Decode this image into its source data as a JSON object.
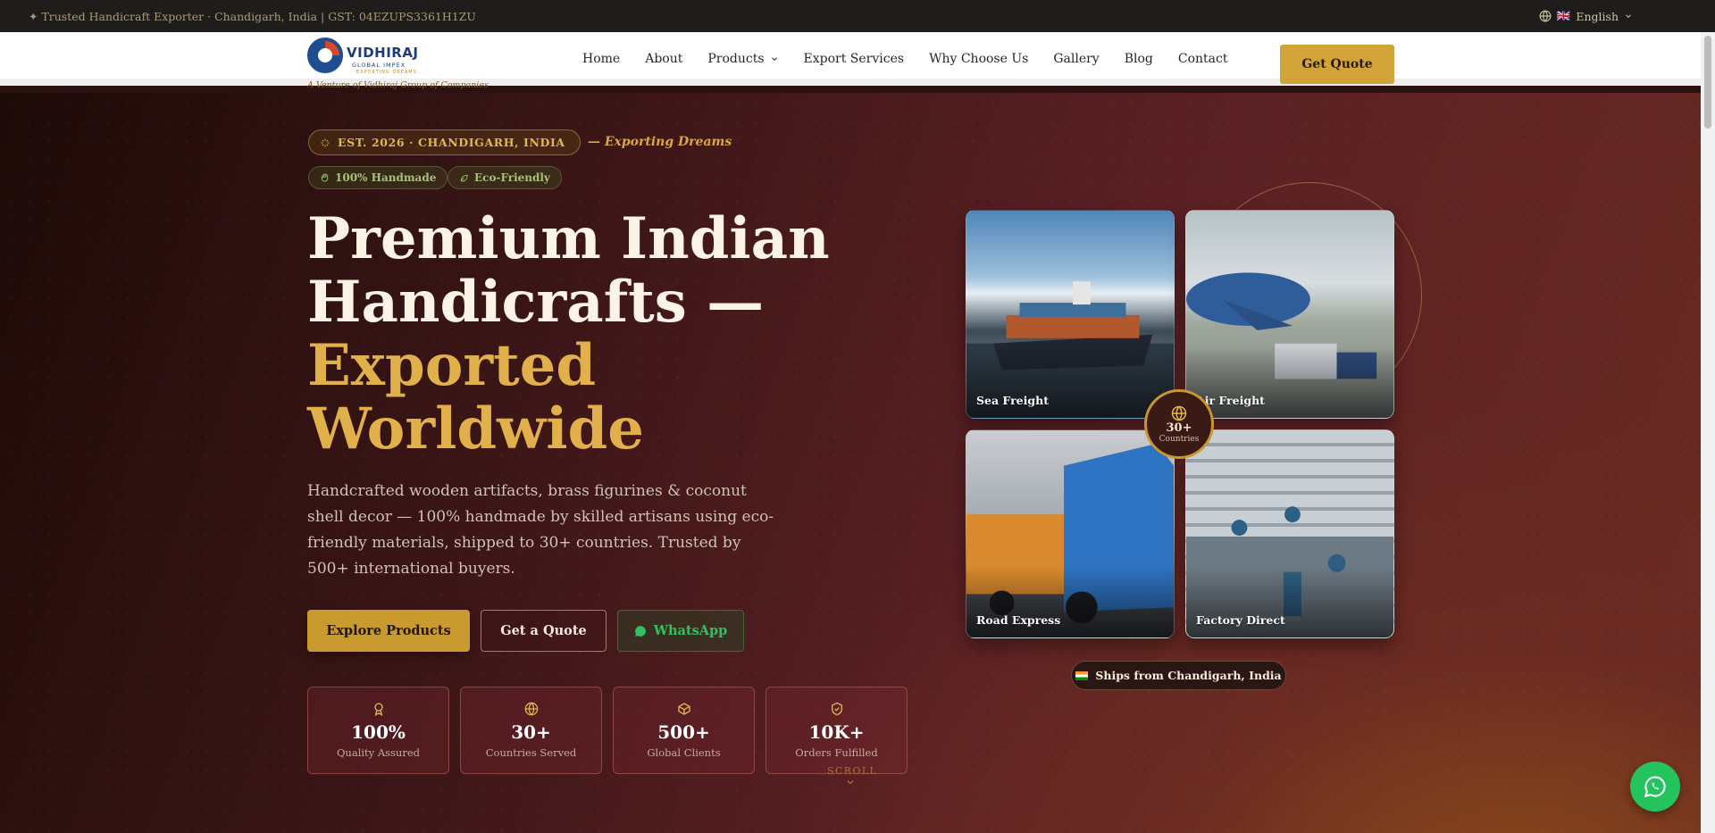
{
  "topbar": {
    "tagline": "✦ Trusted Handicraft Exporter · Chandigarh, India  |  GST: 04EZUPS3361H1ZU",
    "language_flag": "🇬🇧",
    "language": "English"
  },
  "header": {
    "logo_brand": "VIDHIRAJ",
    "logo_sub": "GLOBAL IMPEX",
    "logo_sub2": "EXPORTING DREAMS",
    "logo_tagline": "A Venture of Vidhiraj Group of Companies",
    "nav": [
      "Home",
      "About",
      "Products",
      "Export Services",
      "Why Choose Us",
      "Gallery",
      "Blog",
      "Contact"
    ],
    "cta": "Get Quote"
  },
  "hero": {
    "est_pill": "EST. 2026 · CHANDIGARH, INDIA",
    "exporting": "— Exporting Dreams",
    "badges": [
      "100% Handmade",
      "Eco-Friendly"
    ],
    "title_line1": "Premium Indian",
    "title_line2": "Handicrafts —",
    "title_line3": "Exported",
    "title_line4": "Worldwide",
    "description": "Handcrafted wooden artifacts, brass figurines & coconut shell decor — 100% handmade by skilled artisans using eco-friendly materials, shipped to 30+ countries. Trusted by 500+ international buyers.",
    "buttons": {
      "explore": "Explore Products",
      "quote": "Get a Quote",
      "whatsapp": "WhatsApp"
    },
    "stats": [
      {
        "value": "100%",
        "label": "Quality Assured",
        "icon": "award-icon"
      },
      {
        "value": "30+",
        "label": "Countries Served",
        "icon": "globe-icon"
      },
      {
        "value": "500+",
        "label": "Global Clients",
        "icon": "box-icon"
      },
      {
        "value": "10K+",
        "label": "Orders Fulfilled",
        "icon": "shield-icon"
      }
    ],
    "scroll": "SCROLL"
  },
  "gallery": {
    "cards": [
      "Sea Freight",
      "Air Freight",
      "Road Express",
      "Factory Direct"
    ],
    "countries_value": "30+",
    "countries_label": "Countries",
    "ships_flag": "🇮🇳",
    "ships_from": "Ships from Chandigarh, India"
  },
  "colors": {
    "accent_gold": "#d1a43a",
    "whatsapp_green": "#24c35d",
    "hero_dark": "#2a1210"
  }
}
